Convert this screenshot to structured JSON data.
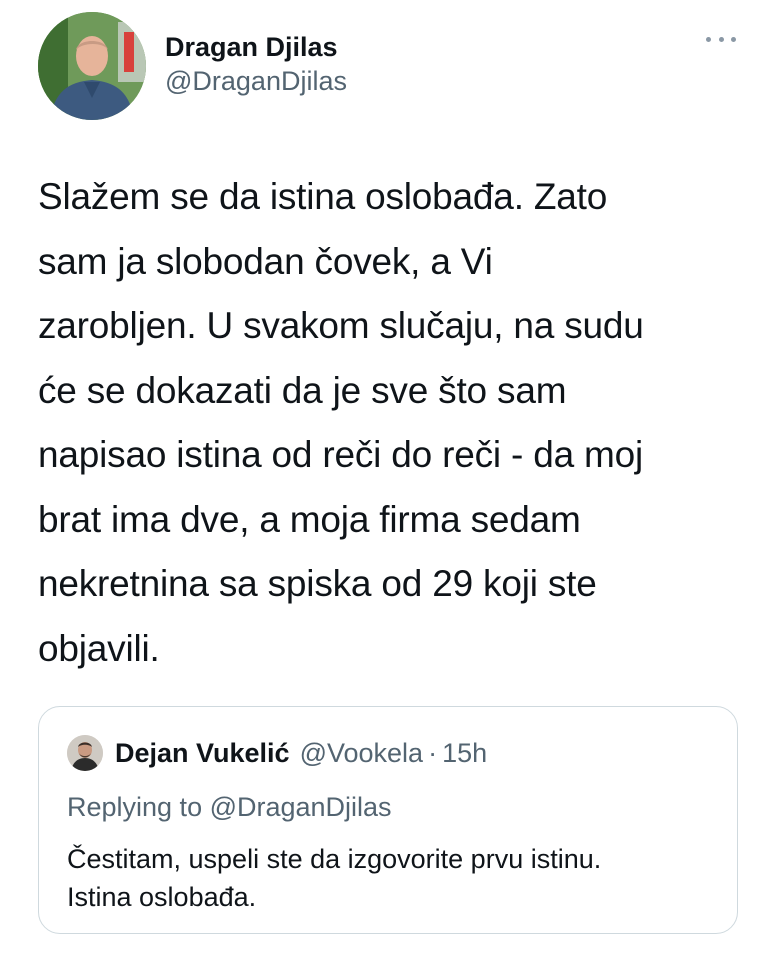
{
  "author": {
    "display_name": "Dragan Djilas",
    "handle": "@DraganDjilas"
  },
  "menu_icon": "more-horizontal-icon",
  "tweet": {
    "text": "Slažem se da istina oslobađa. Zato\nsam ja slobodan čovek, a Vi\nzarobljen. U svakom slučaju, na sudu\nće se dokazati da je sve što sam\nnapisao istina od reči do reči - da moj\nbrat ima dve, a moja firma sedam\nnekretnina sa spiska od 29 koji ste\nobjavili."
  },
  "quoted_tweet": {
    "display_name": "Dejan Vukelić",
    "handle": "@Vookela",
    "separator": "·",
    "time": "15h",
    "replying_to": "Replying to @DraganDjilas",
    "text": "Čestitam, uspeli ste da izgovorite prvu istinu.\nIstina oslobađa."
  },
  "colors": {
    "text_primary": "#0f1419",
    "text_secondary": "#536471",
    "border": "#cfd9de"
  }
}
